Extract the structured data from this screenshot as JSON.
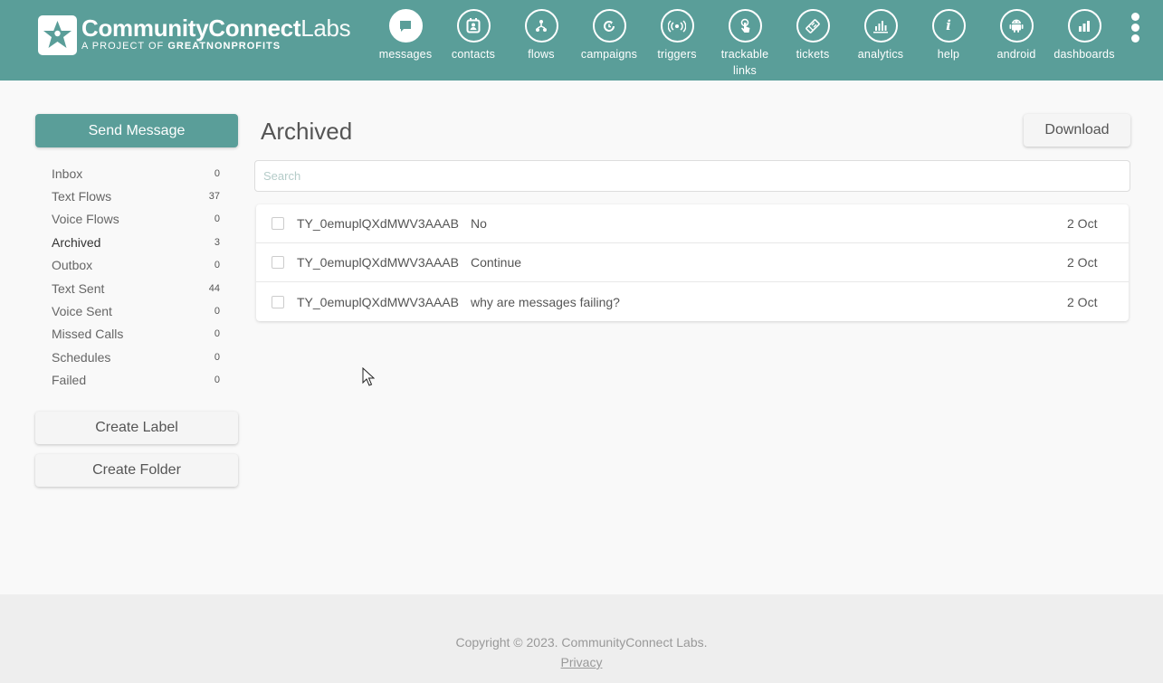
{
  "brand": {
    "name_bold": "CommunityConnect",
    "name_light": "Labs",
    "tagline_prefix": "A PROJECT OF ",
    "tagline_org": "GREATNONPROFITS",
    "logo_icon": "star-people-icon"
  },
  "nav": {
    "items": [
      {
        "label": "messages",
        "icon": "chat-bubble-icon",
        "active": true
      },
      {
        "label": "contacts",
        "icon": "contact-card-icon"
      },
      {
        "label": "flows",
        "icon": "flow-tree-icon"
      },
      {
        "label": "campaigns",
        "icon": "refresh-clock-icon"
      },
      {
        "label": "triggers",
        "icon": "broadcast-icon"
      },
      {
        "label": "trackable links",
        "icon": "touch-icon"
      },
      {
        "label": "tickets",
        "icon": "ticket-icon"
      },
      {
        "label": "analytics",
        "icon": "bar-chart-icon"
      },
      {
        "label": "help",
        "icon": "info-icon"
      },
      {
        "label": "android",
        "icon": "android-icon"
      },
      {
        "label": "dashboards",
        "icon": "dashboard-chart-icon"
      }
    ],
    "more_icon": "kebab-menu-icon"
  },
  "sidebar": {
    "send_message": "Send Message",
    "folders": [
      {
        "label": "Inbox",
        "count": "0"
      },
      {
        "label": "Text Flows",
        "count": "37"
      },
      {
        "label": "Voice Flows",
        "count": "0"
      },
      {
        "label": "Archived",
        "count": "3",
        "active": true
      },
      {
        "label": "Outbox",
        "count": "0"
      },
      {
        "label": "Text Sent",
        "count": "44"
      },
      {
        "label": "Voice Sent",
        "count": "0"
      },
      {
        "label": "Missed Calls",
        "count": "0"
      },
      {
        "label": "Schedules",
        "count": "0"
      },
      {
        "label": "Failed",
        "count": "0"
      }
    ],
    "create_label": "Create Label",
    "create_folder": "Create Folder"
  },
  "main": {
    "title": "Archived",
    "download": "Download",
    "search_placeholder": "Search",
    "messages": [
      {
        "contact": "TY_0emuplQXdMWV3AAAB",
        "text": "No",
        "date": "2 Oct"
      },
      {
        "contact": "TY_0emuplQXdMWV3AAAB",
        "text": "Continue",
        "date": "2 Oct"
      },
      {
        "contact": "TY_0emuplQXdMWV3AAAB",
        "text": "why are messages failing?",
        "date": "2 Oct"
      }
    ]
  },
  "footer": {
    "copyright": "Copyright © 2023. CommunityConnect Labs.",
    "privacy": "Privacy"
  },
  "colors": {
    "brand": "#5a9e99",
    "footer_bg": "#eeeeee",
    "page_bg": "#f9f9f9"
  }
}
